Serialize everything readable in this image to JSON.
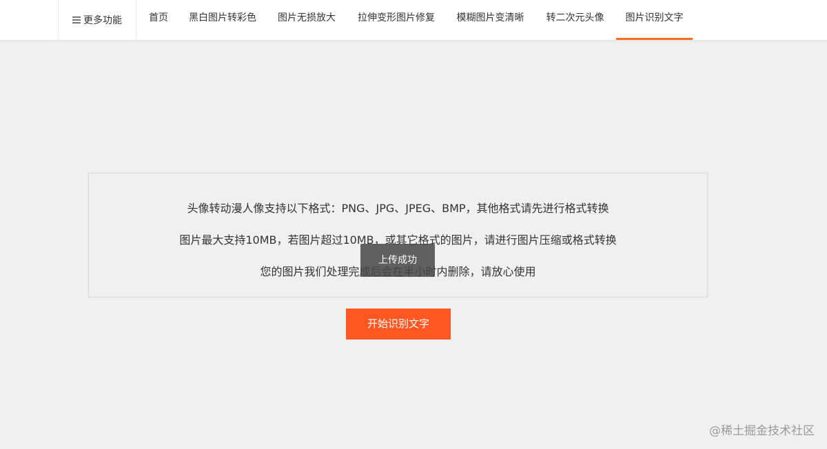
{
  "topbar": {
    "more_label": "更多功能",
    "menu_icon": "hamburger-icon",
    "nav": [
      {
        "label": "首页",
        "active": false
      },
      {
        "label": "黑白图片转彩色",
        "active": false
      },
      {
        "label": "图片无损放大",
        "active": false
      },
      {
        "label": "拉伸变形图片修复",
        "active": false
      },
      {
        "label": "模糊图片变清晰",
        "active": false
      },
      {
        "label": "转二次元头像",
        "active": false
      },
      {
        "label": "图片识别文字",
        "active": true
      }
    ],
    "accent_color": "#f86a1e"
  },
  "notice": {
    "lines": [
      "头像转动漫人像支持以下格式：PNG、JPG、JPEG、BMP，其他格式请先进行格式转换",
      "图片最大支持10MB，若图片超过10MB，或其它格式的图片，请进行图片压缩或格式转换",
      "您的图片我们处理完成后会在半小时内删除，请放心使用"
    ]
  },
  "toast": {
    "message": "上传成功"
  },
  "action": {
    "start_label": "开始识别文字",
    "button_color": "#ff5722"
  },
  "watermark": {
    "text": "@稀土掘金技术社区"
  }
}
